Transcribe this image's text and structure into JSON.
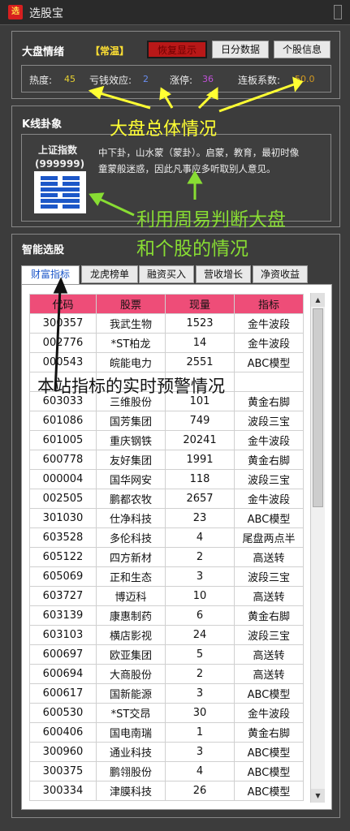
{
  "window": {
    "title": "选股宝",
    "app_icon_text": "选"
  },
  "market": {
    "section_title": "大盘情绪",
    "mood_badge": "【常温】",
    "buttons": [
      "恢复显示",
      "日分数据",
      "个股信息"
    ],
    "stats": [
      {
        "label": "热度:",
        "value": "45",
        "color": "#e8d230"
      },
      {
        "label": "亏钱效应:",
        "value": "2",
        "color": "#6a8ef0"
      },
      {
        "label": "涨停:",
        "value": "36",
        "color": "#c050d8"
      },
      {
        "label": "连板系数:",
        "value": "50.0",
        "color": "#d49a20"
      }
    ]
  },
  "kline": {
    "section_title": "K线卦象",
    "index_name": "上证指数",
    "index_code": "(999999)",
    "description": "中下卦，山水蒙（蒙卦）。启蒙，教育，最初时像童蒙般迷惑，因此凡事应多听取别人意见。",
    "hexagram_icon": "meng-hexagram-icon"
  },
  "smart": {
    "section_title": "智能选股",
    "tabs": [
      "财富指标",
      "龙虎榜单",
      "融资买入",
      "营收增长",
      "净资收益"
    ],
    "columns": [
      "代码",
      "股票",
      "现量",
      "指标"
    ],
    "rows": [
      [
        "300357",
        "我武生物",
        "1523",
        "金牛波段"
      ],
      [
        "002776",
        "*ST柏龙",
        "14",
        "金牛波段"
      ],
      [
        "000543",
        "皖能电力",
        "2551",
        "ABC模型"
      ],
      [
        "",
        "",
        "",
        ""
      ],
      [
        "603033",
        "三维股份",
        "101",
        "黄金右脚"
      ],
      [
        "601086",
        "国芳集团",
        "749",
        "波段三宝"
      ],
      [
        "601005",
        "重庆钢铁",
        "20241",
        "金牛波段"
      ],
      [
        "600778",
        "友好集团",
        "1991",
        "黄金右脚"
      ],
      [
        "000004",
        "国华网安",
        "118",
        "波段三宝"
      ],
      [
        "002505",
        "鹏都农牧",
        "2657",
        "金牛波段"
      ],
      [
        "301030",
        "仕净科技",
        "23",
        "ABC模型"
      ],
      [
        "603528",
        "多伦科技",
        "4",
        "尾盘两点半"
      ],
      [
        "605122",
        "四方新材",
        "2",
        "高送转"
      ],
      [
        "605069",
        "正和生态",
        "3",
        "波段三宝"
      ],
      [
        "603727",
        "博迈科",
        "10",
        "高送转"
      ],
      [
        "603139",
        "康惠制药",
        "6",
        "黄金右脚"
      ],
      [
        "603103",
        "横店影视",
        "24",
        "波段三宝"
      ],
      [
        "600697",
        "欧亚集团",
        "5",
        "高送转"
      ],
      [
        "600694",
        "大商股份",
        "2",
        "高送转"
      ],
      [
        "600617",
        "国新能源",
        "3",
        "ABC模型"
      ],
      [
        "600530",
        "*ST交昂",
        "30",
        "金牛波段"
      ],
      [
        "600406",
        "国电南瑞",
        "1",
        "黄金右脚"
      ],
      [
        "300960",
        "通业科技",
        "3",
        "ABC模型"
      ],
      [
        "300375",
        "鹏翎股份",
        "4",
        "ABC模型"
      ],
      [
        "300334",
        "津膜科技",
        "26",
        "ABC模型"
      ]
    ]
  },
  "annotations": {
    "overall": "大盘总体情况",
    "iching_line1": "利用周易判断大盘",
    "iching_line2": "和个股的情况",
    "realtime": "本站指标的实时预警情况"
  },
  "colors": {
    "accent_red": "#b81818",
    "header_pink": "#ee4d78",
    "annot_yellow": "#ffff33",
    "annot_green": "#88dd33"
  }
}
